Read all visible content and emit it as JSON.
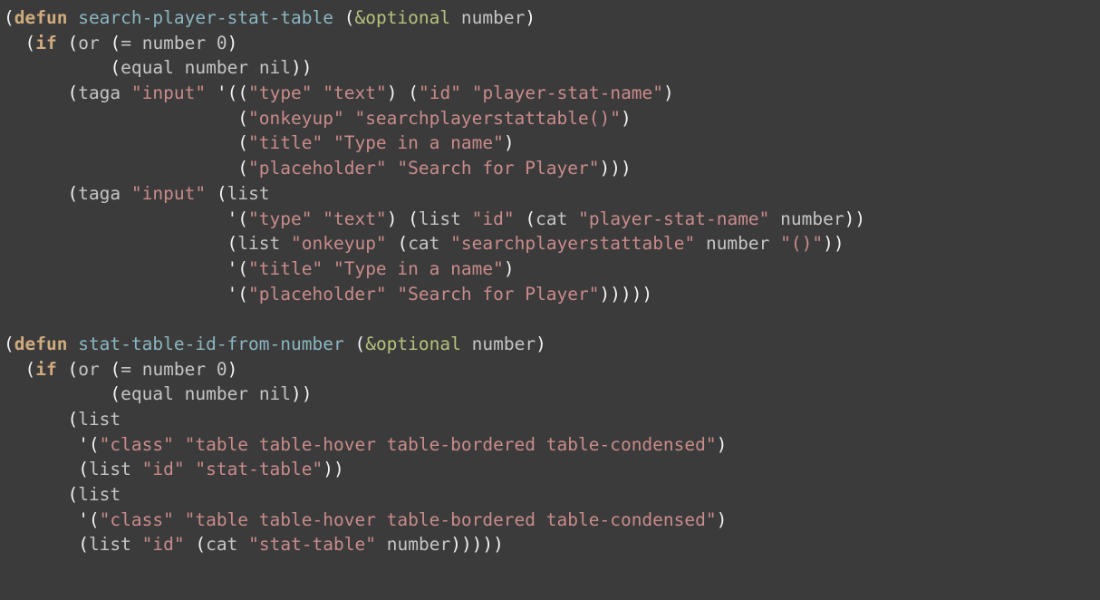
{
  "tokens": {
    "kw_defun": "defun",
    "kw_if": "if",
    "fn1": "search-player-stat-table",
    "fn2": "stat-table-id-from-number",
    "bi_opt": "&optional",
    "id_number": "number",
    "id_or": "or",
    "id_eq": "=",
    "id_equal": "equal",
    "id_nil": "nil",
    "id_taga": "taga",
    "id_list": "list",
    "id_cat": "cat",
    "lit_0": "0",
    "s_input": "\"input\"",
    "s_type": "\"type\"",
    "s_text": "\"text\"",
    "s_id": "\"id\"",
    "s_player_stat_name": "\"player-stat-name\"",
    "s_onkeyup": "\"onkeyup\"",
    "s_searchfn": "\"searchplayerstattable()\"",
    "s_searchfn_base": "\"searchplayerstattable\"",
    "s_title": "\"title\"",
    "s_type_name": "\"Type in a name\"",
    "s_placeholder": "\"placeholder\"",
    "s_search_for_player": "\"Search for Player\"",
    "s_parens_call": "\"()\"",
    "s_class": "\"class\"",
    "s_table_classes": "\"table table-hover table-bordered table-condensed\"",
    "s_stat_table": "\"stat-table\""
  }
}
